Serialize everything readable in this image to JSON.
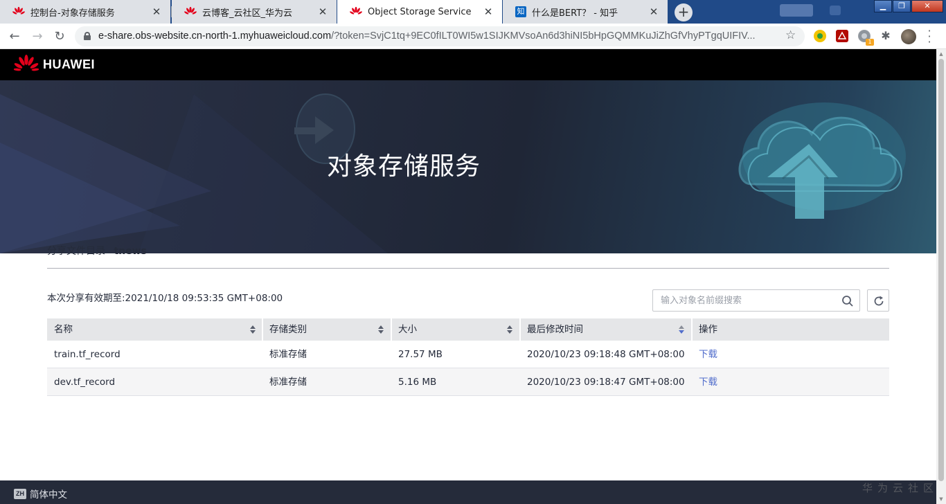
{
  "browser": {
    "tabs": [
      {
        "title": "控制台-对象存储服务",
        "icon": "huawei-logo-icon",
        "active": false
      },
      {
        "title": "云博客_云社区_华为云",
        "icon": "huawei-logo-icon",
        "active": false
      },
      {
        "title": "Object Storage Service",
        "icon": "huawei-logo-icon",
        "active": true
      },
      {
        "title": "什么是BERT？ - 知乎",
        "icon": "zhihu-icon",
        "active": false
      }
    ],
    "url_host": "e-share.obs-website.cn-north-1.myhuaweicloud.com",
    "url_rest": "/?token=SvjC1tq+9EC0fILT0WI5w1SIJKMVsoAn6d3hiNI5bHpGQMMKuJiZhGfVhyPTgqUIFIV...",
    "zhihu_glyph": "知",
    "ext_badge": "1"
  },
  "page": {
    "brand": "HUAWEI",
    "banner_title": "对象存储服务",
    "dir_label": "分享文件目录",
    "dir_name": "tnews",
    "expiry": "本次分享有效期至:2021/10/18 09:53:35 GMT+08:00",
    "search_placeholder": "输入对象名前缀搜索",
    "columns": {
      "name": "名称",
      "storage": "存储类别",
      "size": "大小",
      "modified": "最后修改时间",
      "action": "操作"
    },
    "rows": [
      {
        "name": "train.tf_record",
        "storage": "标准存储",
        "size": "27.57 MB",
        "modified": "2020/10/23 09:18:48 GMT+08:00",
        "action": "下载"
      },
      {
        "name": "dev.tf_record",
        "storage": "标准存储",
        "size": "5.16 MB",
        "modified": "2020/10/23 09:18:47 GMT+08:00",
        "action": "下载"
      }
    ],
    "language": "简体中文",
    "language_icon_text": "ZH",
    "watermark": "华为云社区"
  },
  "colors": {
    "link": "#526ecc",
    "header_bg": "#000000",
    "footer_bg": "#252b3a",
    "table_head": "#e5e6e8",
    "tabstrip": "#204a88"
  }
}
